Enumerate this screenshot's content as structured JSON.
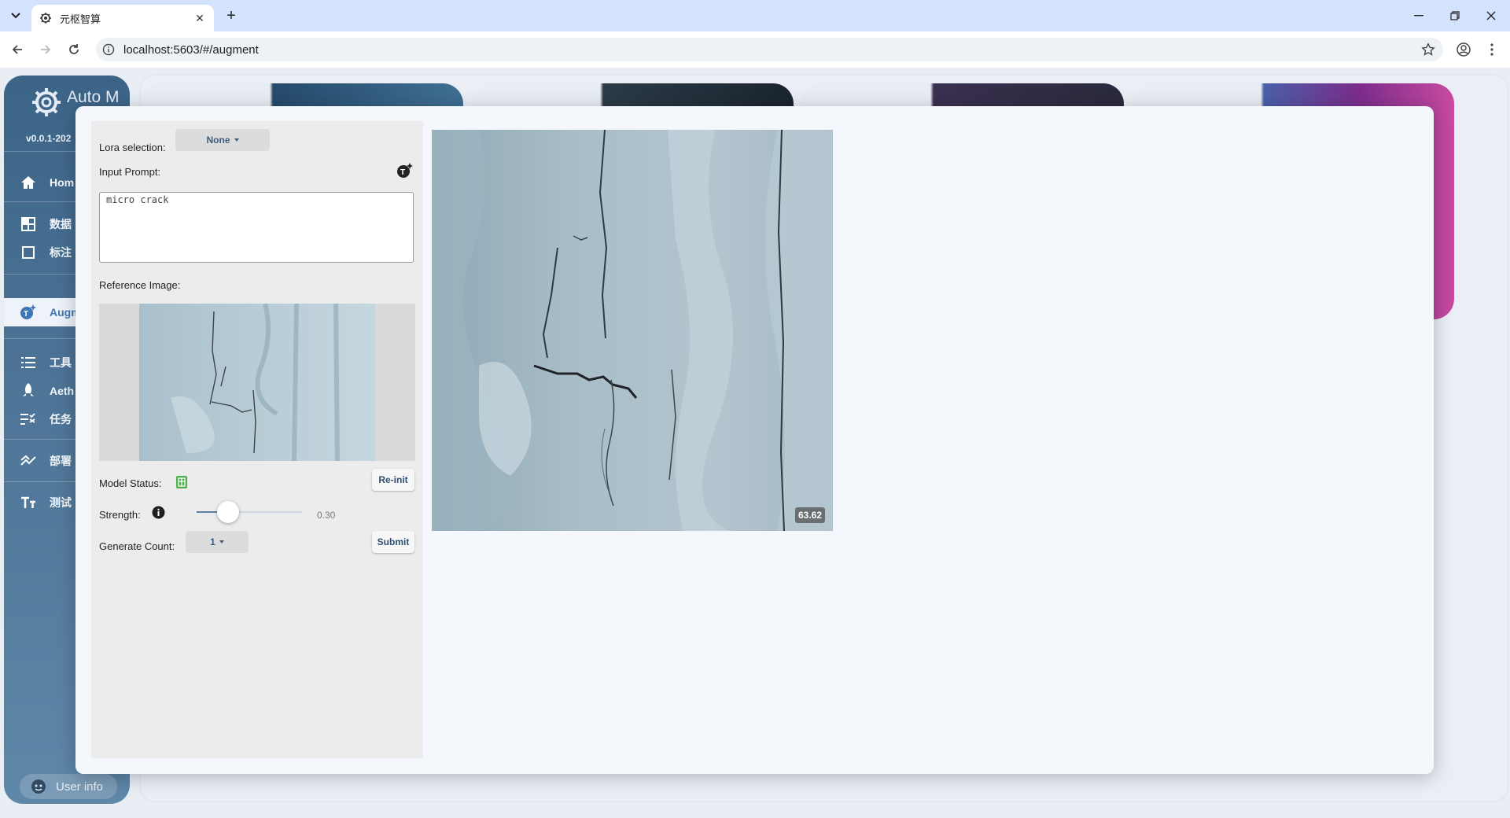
{
  "browser": {
    "tab_title": "元枢智算",
    "url": "localhost:5603/#/augment"
  },
  "sidebar": {
    "logo_text": "Auto M",
    "version": "v0.0.1-202",
    "items": [
      {
        "label": "Hom",
        "icon": "home-icon"
      },
      {
        "label": "数据",
        "icon": "grid-icon"
      },
      {
        "label": "标注",
        "icon": "square-icon"
      },
      {
        "label": "Augm",
        "icon": "augment-icon",
        "active": true
      },
      {
        "label": "工具",
        "icon": "list-icon"
      },
      {
        "label": "Aeth",
        "icon": "rocket-icon"
      },
      {
        "label": "任务",
        "icon": "task-list-icon"
      },
      {
        "label": "部署",
        "icon": "deploy-icon"
      },
      {
        "label": "测试",
        "icon": "text-icon"
      }
    ],
    "user_info": "User info"
  },
  "augment": {
    "lora_label": "Lora selection:",
    "lora_value": "None",
    "prompt_label": "Input Prompt:",
    "prompt_value": "micro crack",
    "reference_label": "Reference Image:",
    "model_status_label": "Model Status:",
    "reinit_label": "Re-init",
    "strength_label": "Strength:",
    "strength_value": "0.30",
    "strength_fraction": 0.3,
    "generate_count_label": "Generate Count:",
    "generate_count_value": "1",
    "submit_label": "Submit",
    "result_score": "63.62"
  },
  "colors": {
    "accent": "#3d77b3",
    "status_ok": "#4caf50",
    "sidebar_top": "#3c6487"
  }
}
